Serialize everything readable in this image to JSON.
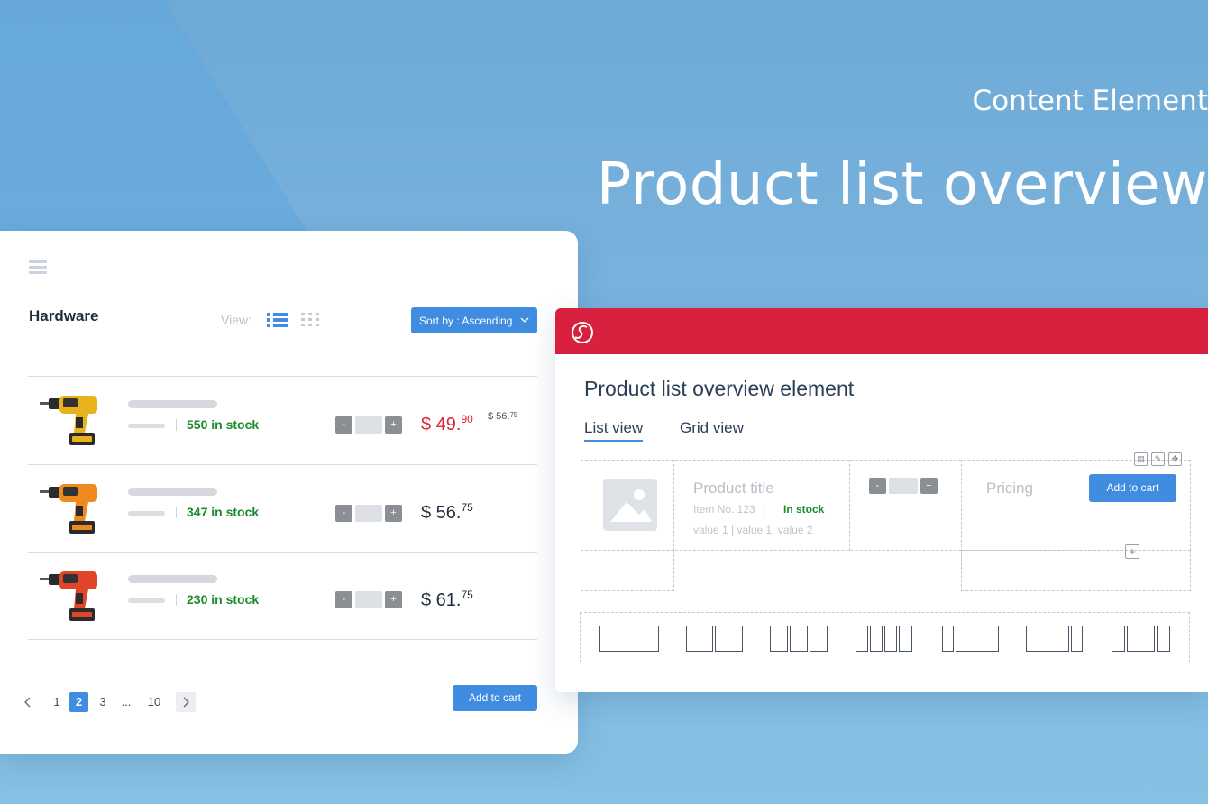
{
  "hero": {
    "subtitle": "Content Element",
    "title": "Product list overview"
  },
  "left_panel": {
    "menu_icon": "hamburger-menu-icon",
    "category_title": "Hardware",
    "view_label": "View:",
    "view_icons": [
      "list-view-icon",
      "grid-view-icon"
    ],
    "sort_label": "Sort by : Ascending",
    "products": [
      {
        "stock": "550 in stock",
        "price_main": "$ 49.",
        "price_cents": "90",
        "old_price_main": "$ 56.",
        "old_price_cents": "75",
        "on_sale": true,
        "drill_color": "#e8b21c"
      },
      {
        "stock": "347 in stock",
        "price_main": "$ 56.",
        "price_cents": "75",
        "on_sale": false,
        "drill_color": "#ef8a1e"
      },
      {
        "stock": "230 in stock",
        "price_main": "$ 61.",
        "price_cents": "75",
        "on_sale": false,
        "drill_color": "#e2452a"
      }
    ],
    "stepper": {
      "minus": "-",
      "plus": "+"
    },
    "pagination": {
      "prev": "<",
      "pages": [
        "1",
        "2",
        "3",
        "...",
        "10"
      ],
      "active": "2",
      "next": ">"
    },
    "add_to_cart": "Add to cart"
  },
  "right_panel": {
    "logo_icon": "brand-logo-icon",
    "title": "Product list overview element",
    "tabs": [
      {
        "label": "List view",
        "active": true
      },
      {
        "label": "Grid view",
        "active": false
      }
    ],
    "toolbar_icons": [
      "delete-icon",
      "edit-icon",
      "move-icon"
    ],
    "product_title": "Product title",
    "item_no": "Item No. 123",
    "separator": "|",
    "in_stock": "In stock",
    "values": "value 1 | value 1, value 2",
    "stepper": {
      "minus": "-",
      "plus": "+"
    },
    "pricing": "Pricing",
    "add_to_cart": "Add to cart",
    "add_icon": "+"
  },
  "colors": {
    "accent_blue": "#3f8ce0",
    "brand_red": "#d7213f",
    "sale_red": "#d8253f",
    "stock_green": "#1a8a2c"
  }
}
